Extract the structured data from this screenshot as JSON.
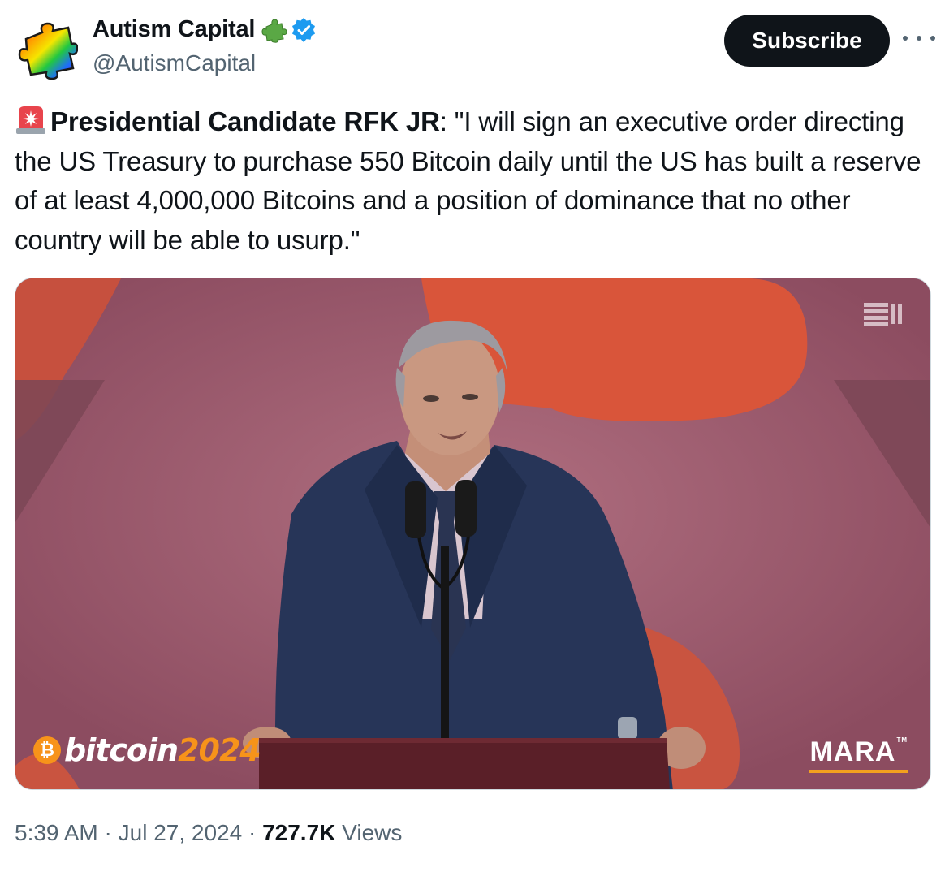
{
  "author": {
    "display_name": "Autism Capital",
    "handle": "@AutismCapital",
    "avatar_icon": "rainbow-puzzle-piece-icon",
    "badge_icon": "green-puzzle-piece-icon",
    "verified_icon": "blue-verified-checkmark-icon"
  },
  "header": {
    "subscribe_label": "Subscribe",
    "more_icon": "more-dots-icon"
  },
  "tweet": {
    "emoji": "rotating-light-siren-icon",
    "bold_lead": "Presidential Candidate RFK JR",
    "body": ": \"I will sign an executive order directing the US Treasury to purchase 550 Bitcoin daily until the US has built a reserve of at least 4,000,000 Bitcoins and a position of dominance that no other country will be able to usurp.\""
  },
  "media": {
    "type": "video",
    "logo_left_word": "bitcoin",
    "logo_left_year": "2024",
    "logo_right": "MARA",
    "logo_right_tm": "TM",
    "watermark_icon": "video-channel-watermark-icon"
  },
  "meta": {
    "time": "5:39 AM",
    "separator": "·",
    "date": "Jul 27, 2024",
    "views_count": "727.7K",
    "views_label": "Views"
  },
  "colors": {
    "subscribe_bg": "#0f1419",
    "secondary_text": "#536471",
    "verified_blue": "#1d9bf0",
    "bitcoin_orange": "#f7931a"
  }
}
